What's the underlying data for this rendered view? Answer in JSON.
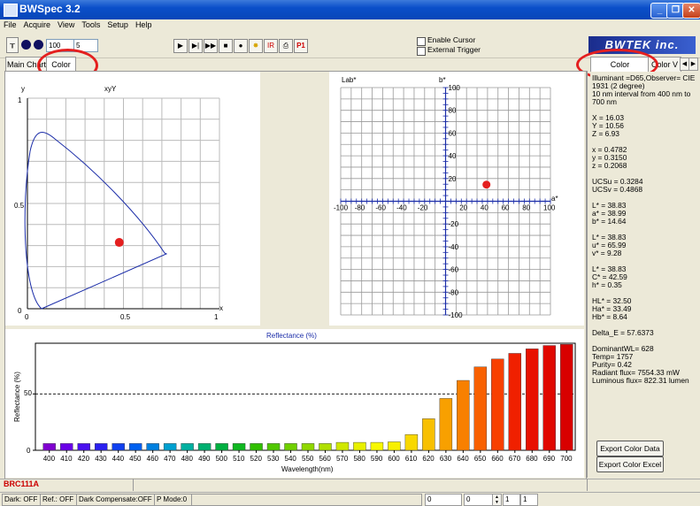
{
  "window": {
    "title": "BWSpec 3.2"
  },
  "menu": [
    "File",
    "Acquire",
    "View",
    "Tools",
    "Setup",
    "Help"
  ],
  "toolbar": {
    "input1": "100",
    "input2": "5",
    "enable_cursor": "Enable Cursor",
    "external_trigger": "External Trigger",
    "logo": "BWTEK inc."
  },
  "tabs": {
    "main_chart": "Main Chart",
    "color": "Color"
  },
  "right_tabs": {
    "color_parameter": "Color Parameter",
    "color_v": "Color V"
  },
  "xyY": {
    "title": "xyY",
    "ylabel": "y",
    "xlabel": "x",
    "yticks": [
      "1",
      "0.5",
      "0"
    ],
    "xticks": [
      "0",
      "0.5",
      "1"
    ],
    "point": {
      "x": 0.4782,
      "y": 0.315
    }
  },
  "lab": {
    "title": "Lab*",
    "b_label": "b*",
    "a_label": "a*",
    "xticks": [
      "-100",
      "-80",
      "-60",
      "-40",
      "-20",
      "20",
      "40",
      "60",
      "80",
      "100"
    ],
    "yticks": [
      "100",
      "80",
      "60",
      "40",
      "20",
      "-20",
      "-40",
      "-60",
      "-80",
      "-100"
    ],
    "point": {
      "a": 38.99,
      "b": 14.64
    }
  },
  "chart_data": {
    "type": "bar",
    "title": "Reflectance (%)",
    "xlabel": "Wavelength(nm)",
    "ylabel": "Reflectance (%)",
    "ylim": [
      0,
      95
    ],
    "yticks": [
      "50",
      "0"
    ],
    "categories": [
      "400",
      "410",
      "420",
      "430",
      "440",
      "450",
      "460",
      "470",
      "480",
      "490",
      "500",
      "510",
      "520",
      "530",
      "540",
      "550",
      "560",
      "570",
      "580",
      "590",
      "600",
      "610",
      "620",
      "630",
      "640",
      "650",
      "660",
      "670",
      "680",
      "690",
      "700"
    ],
    "values": [
      6,
      6,
      6,
      6,
      6,
      6,
      6,
      6,
      6,
      6,
      6,
      6,
      6,
      6,
      6,
      6,
      6,
      7,
      7,
      7,
      7.5,
      14,
      28,
      46,
      62,
      74,
      81,
      86,
      90,
      93,
      94
    ],
    "colors": [
      "#8000d0",
      "#6a00e8",
      "#4a10f0",
      "#2a20f0",
      "#1040f0",
      "#0060f0",
      "#0080e0",
      "#00a0d0",
      "#00b0a0",
      "#00b070",
      "#00b040",
      "#10b820",
      "#30c000",
      "#50c800",
      "#70d000",
      "#90d800",
      "#b0e000",
      "#d0e800",
      "#e8f000",
      "#f8f800",
      "#f8f000",
      "#f8d800",
      "#f8c000",
      "#f8a000",
      "#f88000",
      "#f86000",
      "#f84000",
      "#f02000",
      "#e81000",
      "#e00800",
      "#d80000"
    ],
    "reference_line": 50
  },
  "info": {
    "lines": [
      "Illuminant =D65,Observer= CIE",
      "1931 (2 degree)",
      "10 nm interval from 400 nm to",
      "700 nm",
      "",
      "X = 16.03",
      "Y = 10.56",
      "Z = 6.93",
      "",
      "x = 0.4782",
      "y = 0.3150",
      "z = 0.2068",
      "",
      "UCSu = 0.3284",
      "UCSv = 0.4868",
      "",
      "L* = 38.83",
      "a* = 38.99",
      "b* = 14.64",
      "",
      "L* = 38.83",
      "u* = 65.99",
      "v* = 9.28",
      "",
      "L* = 38.83",
      "C* = 42.59",
      "h* = 0.35",
      "",
      "HL* = 32.50",
      "Ha* = 33.49",
      "Hb* = 8.64",
      "",
      "Delta_E = 57.6373",
      "",
      "DominantWL= 628",
      "Temp= 1757",
      "Purity= 0.42",
      "Radiant flux= 7554.33 mW",
      "Luminous flux= 822.31 lumen"
    ],
    "export_data": "Export Color Data",
    "export_excel": "Export Color Excel"
  },
  "sample_name": "BRC111A",
  "status": {
    "dark": "Dark: OFF",
    "ref": "Ref.: OFF",
    "dark_comp": "Dark Compensate:OFF",
    "pmode": "P Mode:0",
    "field1": "0",
    "field2": "0",
    "field3": "1",
    "field4": "1"
  }
}
